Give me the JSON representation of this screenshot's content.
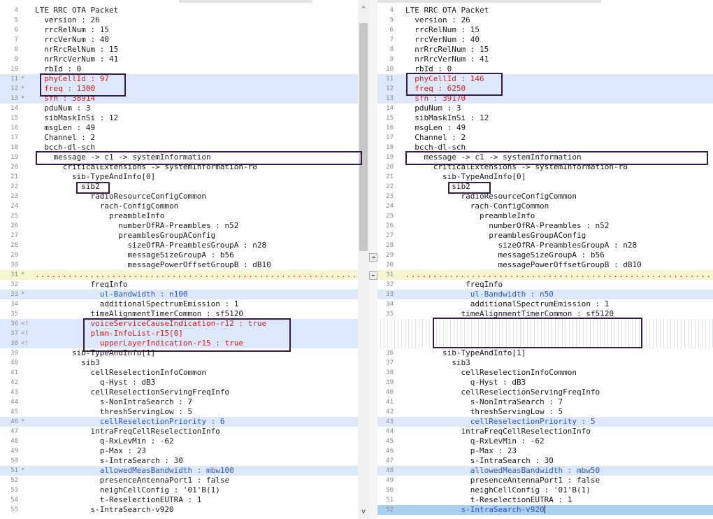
{
  "left": {
    "lines": [
      {
        "n": "4",
        "m": "",
        "t": "LTE RRC OTA Packet",
        "s": "normal"
      },
      {
        "n": "5",
        "m": "",
        "t": "  version : 26",
        "s": "normal"
      },
      {
        "n": "6",
        "m": "",
        "t": "  rrcRelNum : 15",
        "s": "normal"
      },
      {
        "n": "7",
        "m": "",
        "t": "  rrcVerNum : 40",
        "s": "normal"
      },
      {
        "n": "8",
        "m": "",
        "t": "  nrRrcRelNum : 15",
        "s": "normal"
      },
      {
        "n": "9",
        "m": "",
        "t": "  nrRrcVerNum : 41",
        "s": "normal"
      },
      {
        "n": "10",
        "m": "",
        "t": "  rbId : 0",
        "s": "normal"
      },
      {
        "n": "11",
        "m": "*",
        "t": "  phyCellId : 97",
        "s": "diff"
      },
      {
        "n": "12",
        "m": "*",
        "t": "  freq : 1300",
        "s": "diff"
      },
      {
        "n": "13",
        "m": "*",
        "t": "  sfn : 38914",
        "s": "diff"
      },
      {
        "n": "14",
        "m": "",
        "t": "  pduNum : 3",
        "s": "normal"
      },
      {
        "n": "15",
        "m": "",
        "t": "  sibMaskInSi : 12",
        "s": "normal"
      },
      {
        "n": "16",
        "m": "",
        "t": "  msgLen : 49",
        "s": "normal"
      },
      {
        "n": "17",
        "m": "",
        "t": "  Channel : 2",
        "s": "normal"
      },
      {
        "n": "18",
        "m": "",
        "t": "  bcch-dl-sch",
        "s": "normal"
      },
      {
        "n": "19",
        "m": "",
        "t": "    message -> c1 -> systemInformation",
        "s": "normal"
      },
      {
        "n": "20",
        "m": "",
        "t": "      criticalExtensions -> systemInformation-r8",
        "s": "normal"
      },
      {
        "n": "21",
        "m": "",
        "t": "        sib-TypeAndInfo[0]",
        "s": "normal"
      },
      {
        "n": "22",
        "m": "",
        "t": "          sib2",
        "s": "normal"
      },
      {
        "n": "23",
        "m": "",
        "t": "            radioResourceConfigCommon",
        "s": "normal"
      },
      {
        "n": "24",
        "m": "",
        "t": "              rach-ConfigCommon",
        "s": "normal"
      },
      {
        "n": "25",
        "m": "",
        "t": "                preambleInfo",
        "s": "normal"
      },
      {
        "n": "26",
        "m": "",
        "t": "                  numberOfRA-Preambles : n52",
        "s": "normal"
      },
      {
        "n": "27",
        "m": "",
        "t": "                  preamblesGroupAConfig",
        "s": "normal"
      },
      {
        "n": "28",
        "m": "",
        "t": "                    sizeOfRA-PreamblesGroupA : n28",
        "s": "normal"
      },
      {
        "n": "29",
        "m": "",
        "t": "                    messageSizeGroupA : b56",
        "s": "normal"
      },
      {
        "n": "30",
        "m": "",
        "t": "                    messagePowerOffsetGroupB : dB10",
        "s": "normal"
      },
      {
        "n": "31",
        "m": "*",
        "t": "...........................................................",
        "s": "dotted"
      },
      {
        "n": "32",
        "m": "",
        "t": "            freqInfo",
        "s": "normal"
      },
      {
        "n": "33",
        "m": "*",
        "t": "              ul-Bandwidth : n100",
        "s": "blue"
      },
      {
        "n": "34",
        "m": "",
        "t": "              additionalSpectrumEmission : 1",
        "s": "normal"
      },
      {
        "n": "35",
        "m": "",
        "t": "            timeAlignmentTimerCommon : sf5120",
        "s": "normal"
      },
      {
        "n": "36",
        "m": "<!",
        "t": "            voiceServiceCauseIndication-r12 : true",
        "s": "diff"
      },
      {
        "n": "37",
        "m": "<!",
        "t": "            plmn-InfoList-r15[0]",
        "s": "diff"
      },
      {
        "n": "38",
        "m": "<!",
        "t": "              upperLayerIndication-r15 : true",
        "s": "diff"
      },
      {
        "n": "39",
        "m": "",
        "t": "        sib-TypeAndInfo[1]",
        "s": "normal"
      },
      {
        "n": "40",
        "m": "",
        "t": "          sib3",
        "s": "normal"
      },
      {
        "n": "41",
        "m": "",
        "t": "            cellReselectionInfoCommon",
        "s": "normal"
      },
      {
        "n": "42",
        "m": "",
        "t": "              q-Hyst : dB3",
        "s": "normal"
      },
      {
        "n": "43",
        "m": "",
        "t": "            cellReselectionServingFreqInfo",
        "s": "normal"
      },
      {
        "n": "44",
        "m": "",
        "t": "              s-NonIntraSearch : 7",
        "s": "normal"
      },
      {
        "n": "45",
        "m": "",
        "t": "              threshServingLow : 5",
        "s": "normal"
      },
      {
        "n": "46",
        "m": "*",
        "t": "              cellReselectionPriority : 6",
        "s": "blue"
      },
      {
        "n": "47",
        "m": "",
        "t": "            intraFreqCellReselectionInfo",
        "s": "normal"
      },
      {
        "n": "48",
        "m": "",
        "t": "              q-RxLevMin : -62",
        "s": "normal"
      },
      {
        "n": "49",
        "m": "",
        "t": "              p-Max : 23",
        "s": "normal"
      },
      {
        "n": "50",
        "m": "",
        "t": "              s-IntraSearch : 30",
        "s": "normal"
      },
      {
        "n": "51",
        "m": "*",
        "t": "              allowedMeasBandwidth : mbw100",
        "s": "blue"
      },
      {
        "n": "52",
        "m": "",
        "t": "              presenceAntennaPort1 : false",
        "s": "normal"
      },
      {
        "n": "53",
        "m": "",
        "t": "              neighCellConfig : '01'B(1)",
        "s": "normal"
      },
      {
        "n": "54",
        "m": "",
        "t": "              t-ReselectionEUTRA : 1",
        "s": "normal"
      },
      {
        "n": "55",
        "m": "",
        "t": "            s-IntraSearch-v920",
        "s": "normal"
      }
    ]
  },
  "right": {
    "lines": [
      {
        "n": "4",
        "m": "",
        "t": "LTE RRC OTA Packet",
        "s": "normal"
      },
      {
        "n": "5",
        "m": "",
        "t": "  version : 26",
        "s": "normal"
      },
      {
        "n": "6",
        "m": "",
        "t": "  rrcRelNum : 15",
        "s": "normal"
      },
      {
        "n": "7",
        "m": "",
        "t": "  rrcVerNum : 40",
        "s": "normal"
      },
      {
        "n": "8",
        "m": "",
        "t": "  nrRrcRelNum : 15",
        "s": "normal"
      },
      {
        "n": "9",
        "m": "",
        "t": "  nrRrcVerNum : 41",
        "s": "normal"
      },
      {
        "n": "10",
        "m": "",
        "t": "  rbId : 0",
        "s": "normal"
      },
      {
        "n": "11",
        "m": "",
        "t": "  phyCellId : 146",
        "s": "diff"
      },
      {
        "n": "12",
        "m": "",
        "t": "  freq : 6250",
        "s": "diff"
      },
      {
        "n": "13",
        "m": "",
        "t": "  sfn : 39170",
        "s": "diff"
      },
      {
        "n": "14",
        "m": "",
        "t": "  pduNum : 3",
        "s": "normal"
      },
      {
        "n": "15",
        "m": "",
        "t": "  sibMaskInSi : 12",
        "s": "normal"
      },
      {
        "n": "16",
        "m": "",
        "t": "  msgLen : 49",
        "s": "normal"
      },
      {
        "n": "17",
        "m": "",
        "t": "  Channel : 2",
        "s": "normal"
      },
      {
        "n": "18",
        "m": "",
        "t": "  bcch-dl-sch",
        "s": "normal"
      },
      {
        "n": "19",
        "m": "",
        "t": "    message -> c1 -> systemInformation",
        "s": "normal"
      },
      {
        "n": "20",
        "m": "",
        "t": "      criticalExtensions -> systemInformation-r8",
        "s": "normal"
      },
      {
        "n": "21",
        "m": "",
        "t": "        sib-TypeAndInfo[0]",
        "s": "normal"
      },
      {
        "n": "22",
        "m": "",
        "t": "          sib2",
        "s": "normal"
      },
      {
        "n": "23",
        "m": "",
        "t": "            radioResourceConfigCommon",
        "s": "normal"
      },
      {
        "n": "24",
        "m": "",
        "t": "              rach-ConfigCommon",
        "s": "normal"
      },
      {
        "n": "25",
        "m": "",
        "t": "                preambleInfo",
        "s": "normal"
      },
      {
        "n": "26",
        "m": "",
        "t": "                  numberOfRA-Preambles : n52",
        "s": "normal"
      },
      {
        "n": "27",
        "m": "",
        "t": "                  preamblesGroupAConfig",
        "s": "normal"
      },
      {
        "n": "28",
        "m": "",
        "t": "                    sizeOfRA-PreamblesGroupA : n28",
        "s": "normal"
      },
      {
        "n": "29",
        "m": "",
        "t": "                    messageSizeGroupA : b56",
        "s": "normal"
      },
      {
        "n": "30",
        "m": "",
        "t": "                    messagePowerOffsetGroupB : dB10",
        "s": "normal"
      },
      {
        "n": "31",
        "m": "",
        "t": ".........................................................",
        "s": "dotted"
      },
      {
        "n": "32",
        "m": "",
        "t": "             freqInfo",
        "s": "normal"
      },
      {
        "n": "33",
        "m": "",
        "t": "              ul-Bandwidth : n50",
        "s": "blue"
      },
      {
        "n": "34",
        "m": "",
        "t": "              additionalSpectrumEmission : 1",
        "s": "normal"
      },
      {
        "n": "35",
        "m": "",
        "t": "            timeAlignmentTimerCommon : sf5120",
        "s": "normal"
      },
      {
        "n": "",
        "m": "",
        "t": "",
        "s": "hatch"
      },
      {
        "n": "",
        "m": "",
        "t": "",
        "s": "hatch"
      },
      {
        "n": "",
        "m": "",
        "t": "",
        "s": "hatch"
      },
      {
        "n": "36",
        "m": "",
        "t": "        sib-TypeAndInfo[1]",
        "s": "normal"
      },
      {
        "n": "37",
        "m": "",
        "t": "          sib3",
        "s": "normal"
      },
      {
        "n": "38",
        "m": "",
        "t": "            cellReselectionInfoCommon",
        "s": "normal"
      },
      {
        "n": "39",
        "m": "",
        "t": "              q-Hyst : dB3",
        "s": "normal"
      },
      {
        "n": "40",
        "m": "",
        "t": "            cellReselectionServingFreqInfo",
        "s": "normal"
      },
      {
        "n": "41",
        "m": "",
        "t": "              s-NonIntraSearch : 7",
        "s": "normal"
      },
      {
        "n": "42",
        "m": "",
        "t": "              threshServingLow : 5",
        "s": "normal"
      },
      {
        "n": "43",
        "m": "",
        "t": "              cellReselectionPriority : 5",
        "s": "blue"
      },
      {
        "n": "44",
        "m": "",
        "t": "            intraFreqCellReselectionInfo",
        "s": "normal"
      },
      {
        "n": "45",
        "m": "",
        "t": "              q-RxLevMin : -62",
        "s": "normal"
      },
      {
        "n": "46",
        "m": "",
        "t": "              p-Max : 23",
        "s": "normal"
      },
      {
        "n": "47",
        "m": "",
        "t": "              s-IntraSearch : 30",
        "s": "normal"
      },
      {
        "n": "48",
        "m": "",
        "t": "              allowedMeasBandwidth : mbw50",
        "s": "blue"
      },
      {
        "n": "49",
        "m": "",
        "t": "              presenceAntennaPort1 : false",
        "s": "normal"
      },
      {
        "n": "50",
        "m": "",
        "t": "              neighCellConfig : '01'B(1)",
        "s": "normal"
      },
      {
        "n": "51",
        "m": "",
        "t": "              t-ReselectionEUTRA : 1",
        "s": "normal"
      },
      {
        "n": "52",
        "m": "",
        "t": "            s-IntraSearch-v920",
        "s": "selected"
      }
    ]
  },
  "scrollbar": {
    "up_arrow": "^",
    "down_arrow": "v"
  },
  "merge": {
    "copy_right_icon": "➜",
    "copy_left_icon": "⬅"
  },
  "icons": [
    "scroll-up-icon",
    "scroll-down-icon",
    "copy-to-right-icon",
    "copy-to-left-icon"
  ],
  "colors": {
    "diff_text": "#d81f1f",
    "changed_text": "#2f58d6",
    "changed_bg": "#dde8fb",
    "dotted_bg": "#f7f5d0",
    "selected_bg": "#a9d0ee",
    "box_border": "#3a1a4a"
  }
}
